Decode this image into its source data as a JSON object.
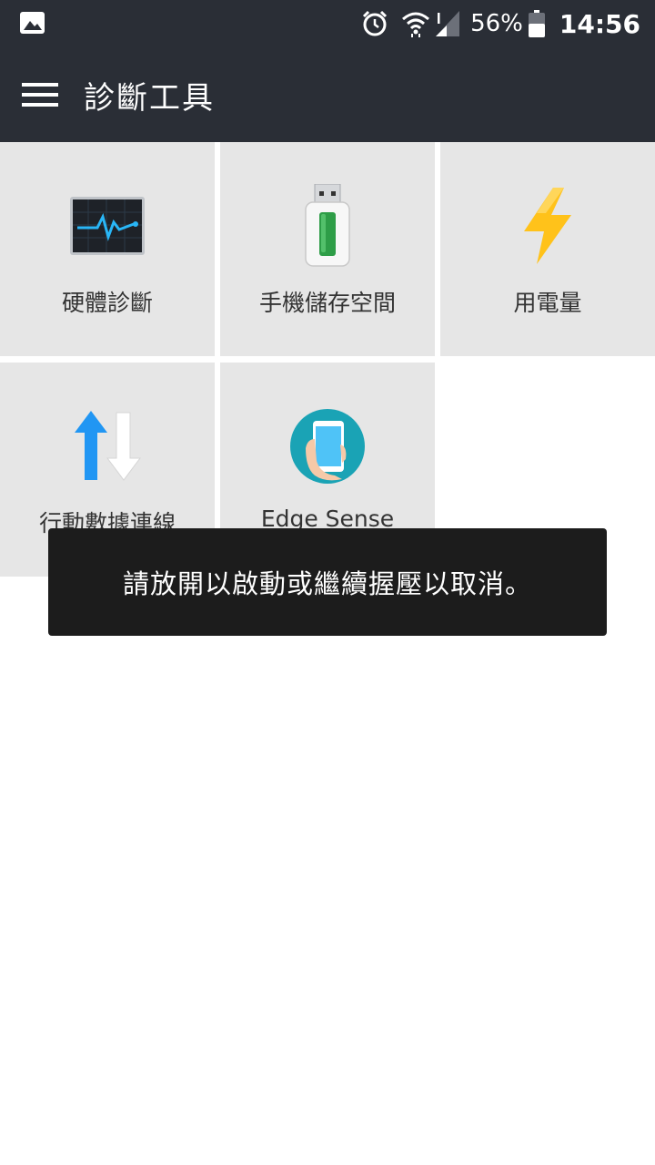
{
  "status_bar": {
    "icons": [
      "gallery-icon",
      "alarm-icon",
      "wifi-icon",
      "signal-icon",
      "battery-icon"
    ],
    "battery": "56%",
    "time": "14:56"
  },
  "app_bar": {
    "menu_icon": "hamburger-menu-icon",
    "title": "診斷工具"
  },
  "tiles": [
    {
      "label": "硬體診斷",
      "icon": "hardware-monitor-icon"
    },
    {
      "label": "手機儲存空間",
      "icon": "usb-storage-icon"
    },
    {
      "label": "用電量",
      "icon": "lightning-icon"
    },
    {
      "label": "行動數據連線",
      "icon": "data-arrows-icon"
    },
    {
      "label": "Edge Sense",
      "icon": "hand-phone-icon"
    }
  ],
  "toast": {
    "message": "請放開以啟動或繼續握壓以取消。"
  },
  "colors": {
    "bar": "#2a2e36",
    "tile": "#e6e6e6",
    "toast": "#1c1c1c",
    "accent_blue": "#2196f3",
    "teal": "#1aa3b5",
    "lightning": "#ffc21a",
    "green": "#2e9d47"
  }
}
